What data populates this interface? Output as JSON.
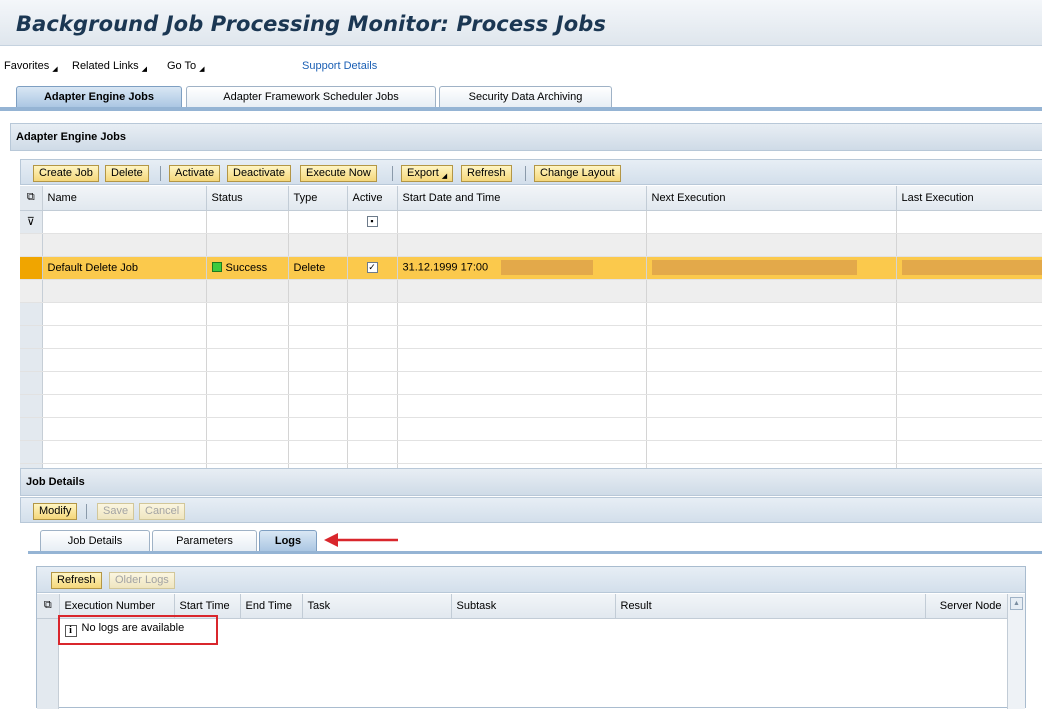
{
  "page": {
    "title": "Background Job Processing Monitor: Process Jobs"
  },
  "menu": {
    "favorites": "Favorites",
    "related_links": "Related Links",
    "go_to": "Go To",
    "support_details": "Support Details"
  },
  "main_tabs": [
    {
      "label": "Adapter Engine Jobs",
      "active": true
    },
    {
      "label": "Adapter Framework Scheduler Jobs",
      "active": false
    },
    {
      "label": "Security Data Archiving",
      "active": false
    }
  ],
  "jobs_section": {
    "header": "Adapter Engine Jobs",
    "toolbar": {
      "create_job": "Create Job",
      "delete": "Delete",
      "activate": "Activate",
      "deactivate": "Deactivate",
      "execute_now": "Execute Now",
      "export": "Export",
      "refresh": "Refresh",
      "change_layout": "Change Layout"
    },
    "columns": [
      "Name",
      "Status",
      "Type",
      "Active",
      "Start Date and Time",
      "Next Execution",
      "Last Execution"
    ],
    "selected_row": {
      "name": "Default Delete Job",
      "status": "Success",
      "type": "Delete",
      "active": "✓",
      "start_date": "31.12.1999",
      "start_time": "17:00"
    }
  },
  "details_section": {
    "header": "Job Details",
    "toolbar": {
      "modify": "Modify",
      "save": "Save",
      "cancel": "Cancel"
    },
    "tabs": [
      {
        "label": "Job Details",
        "active": false
      },
      {
        "label": "Parameters",
        "active": false
      },
      {
        "label": "Logs",
        "active": true
      }
    ]
  },
  "logs": {
    "toolbar": {
      "refresh": "Refresh",
      "older_logs": "Older Logs"
    },
    "columns": [
      "Execution Number",
      "Start Time",
      "End Time",
      "Task",
      "Subtask",
      "Result",
      "Server Node"
    ],
    "empty_message": "No logs are available"
  },
  "colors": {
    "selected_row": "#fbc94c",
    "status_success": "#3ecb3e",
    "highlight_red": "#d9262c",
    "title_text": "#1b3753"
  }
}
